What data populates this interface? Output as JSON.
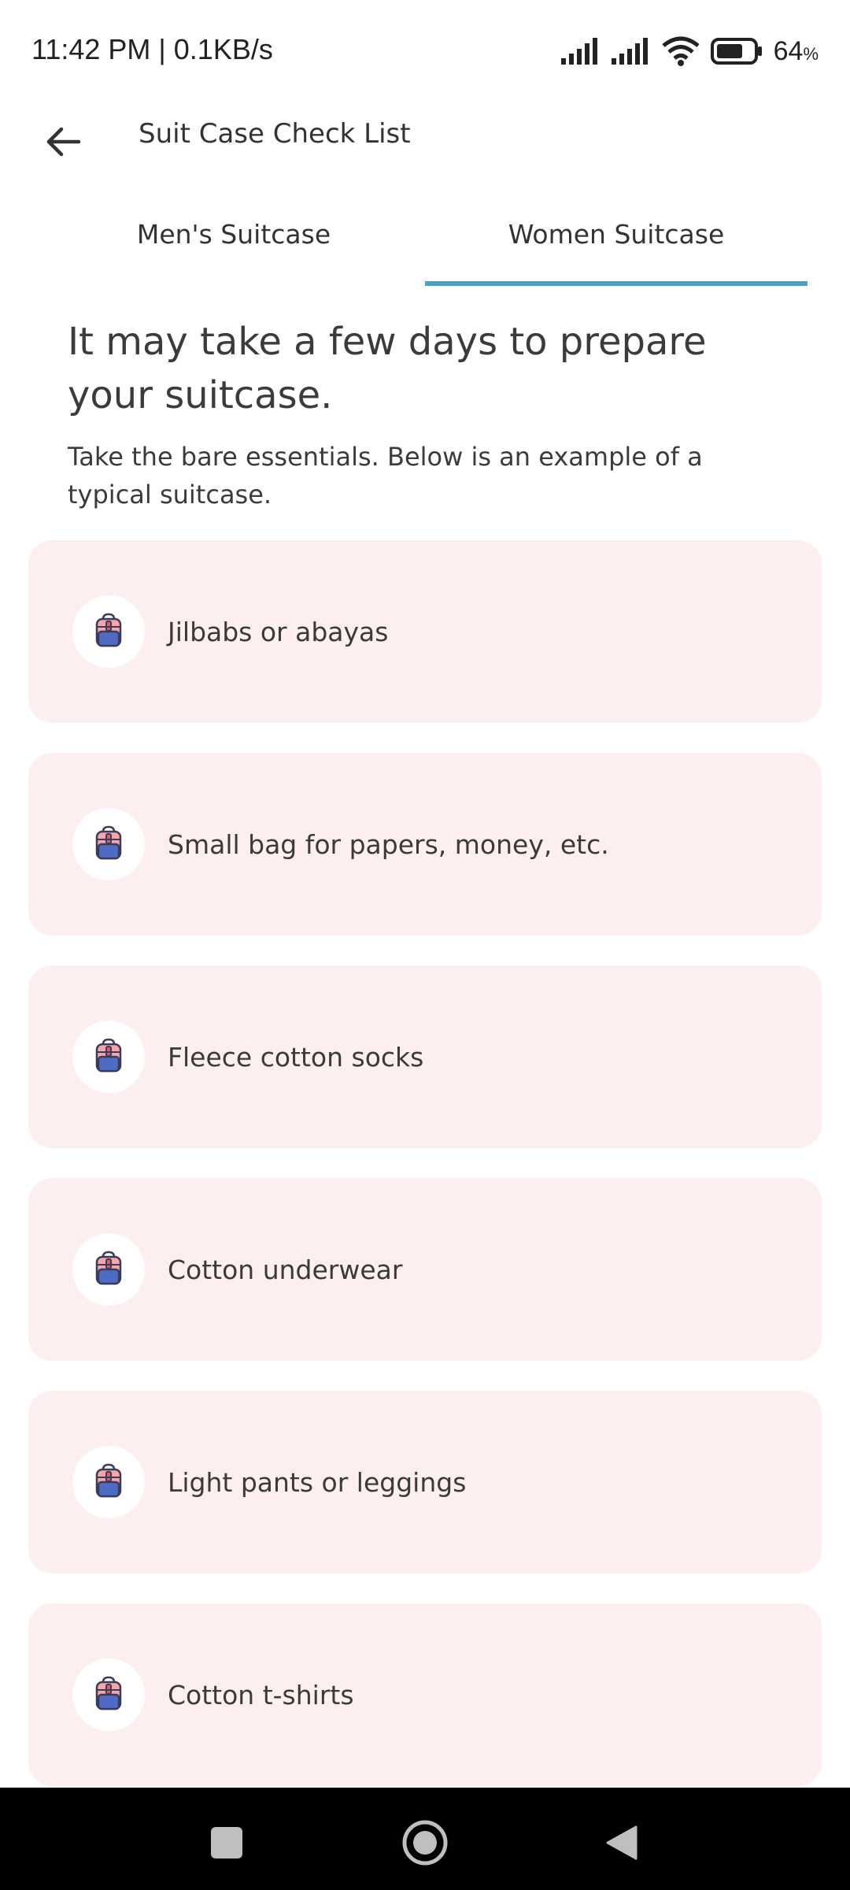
{
  "status": {
    "time": "11:42 PM | 0.1KB/s",
    "battery": "64",
    "battery_unit": "%"
  },
  "header": {
    "title": "Suit Case Check List",
    "back_icon": "arrow-left-icon"
  },
  "tabs": [
    {
      "label": "Men's Suitcase",
      "selected": false
    },
    {
      "label": "Women Suitcase",
      "selected": true
    }
  ],
  "accent_color": "#4a9fc7",
  "card_color": "#fdefef",
  "intro": {
    "headline": "It may take a few days to prepare your suitcase.",
    "subline": "Take the bare essentials. Below is an example of a typical suitcase."
  },
  "items": [
    {
      "label": "Jilbabs or abayas",
      "icon": "backpack-icon"
    },
    {
      "label": "Small bag for papers, money, etc.",
      "icon": "backpack-icon"
    },
    {
      "label": "Fleece cotton socks",
      "icon": "backpack-icon"
    },
    {
      "label": "Cotton underwear",
      "icon": "backpack-icon"
    },
    {
      "label": "Light pants or leggings",
      "icon": "backpack-icon"
    },
    {
      "label": "Cotton t-shirts",
      "icon": "backpack-icon"
    }
  ]
}
